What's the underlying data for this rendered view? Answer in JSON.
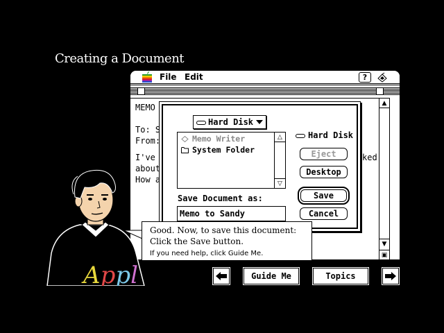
{
  "lesson": {
    "title": "Creating a Document"
  },
  "menubar": {
    "apple_icon": "apple-rainbow-icon",
    "menus": [
      "File",
      "Edit"
    ],
    "help_icon": "balloon-help-icon",
    "help_glyph": "?",
    "app_icon": "app-menu-icon"
  },
  "document": {
    "lines": [
      "MEMO",
      "To: S",
      "From:",
      "I've w",
      "about",
      "How a"
    ],
    "right_fragment": "ked"
  },
  "save_dialog": {
    "location_popup": "Hard Disk",
    "files": [
      {
        "name": "Memo Writer",
        "icon": "application-icon",
        "dimmed": true
      },
      {
        "name": "System Folder",
        "icon": "folder-icon",
        "dimmed": false
      }
    ],
    "disk_name": "Hard Disk",
    "eject_label": "Eject",
    "desktop_label": "Desktop",
    "save_as_label": "Save Document as:",
    "filename_value": "Memo to Sandy",
    "save_label": "Save",
    "cancel_label": "Cancel"
  },
  "bubble": {
    "line1": "Good. Now, to save this document:",
    "line2": "Click the Save button.",
    "hint": "If you need help, click Guide Me."
  },
  "character": {
    "shirt_text": "Appl"
  },
  "nav": {
    "back_icon": "left-arrow-icon",
    "guide_label": "Guide Me",
    "topics_label": "Topics",
    "forward_icon": "right-arrow-icon"
  }
}
